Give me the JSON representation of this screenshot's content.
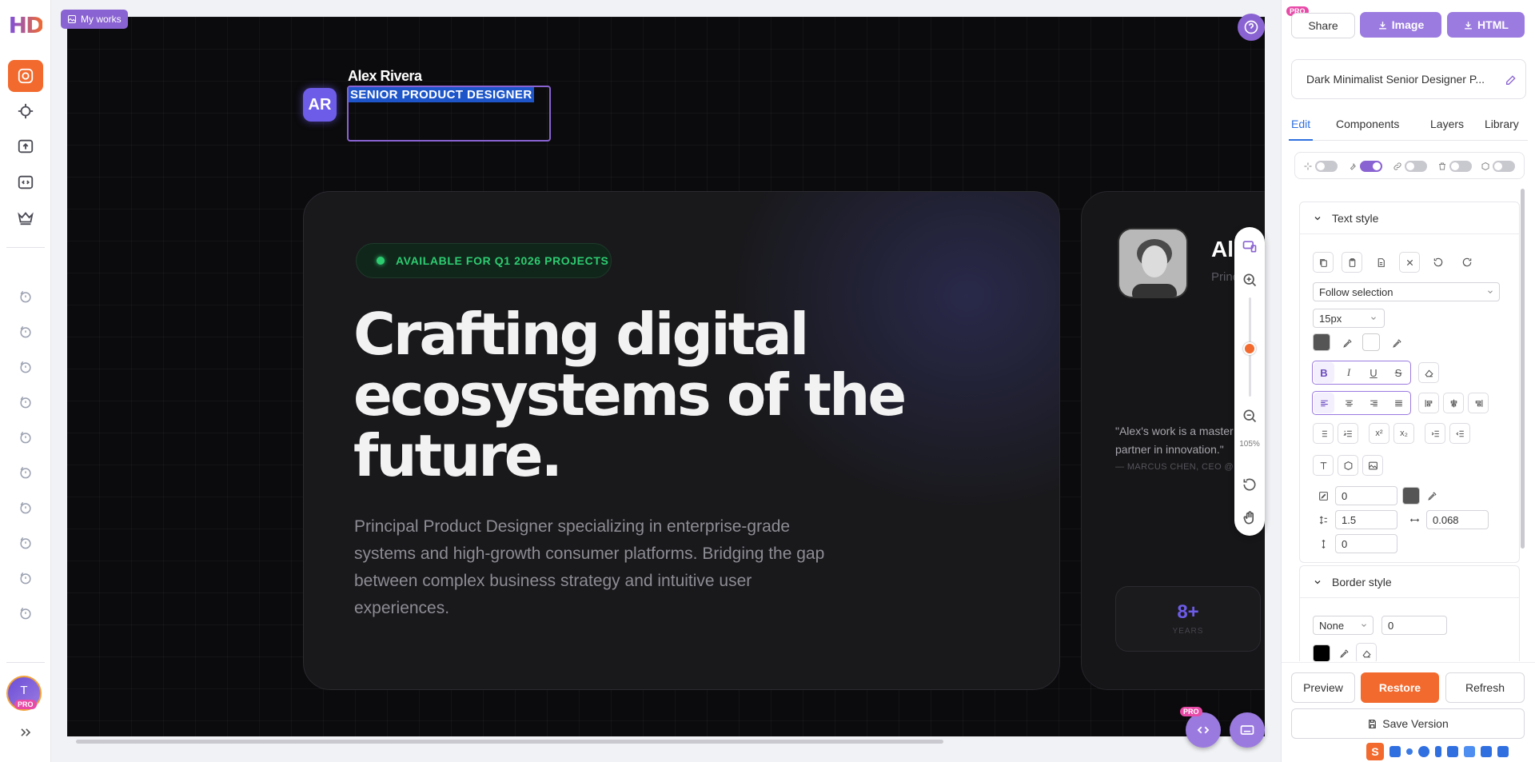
{
  "app": {
    "logo_text": "HD"
  },
  "rail": {
    "user_initial": "T",
    "pro_label": "PRO"
  },
  "canvas": {
    "my_works_label": "My works",
    "header": {
      "initials": "AR",
      "name": "Alex Rivera",
      "role": "SENIOR PRODUCT DESIGNER"
    },
    "main_card": {
      "availability": "AVAILABLE FOR Q1 2026 PROJECTS",
      "headline_line1": "Crafting digital",
      "headline_line2": "ecosystems of the",
      "headline_line3": "future.",
      "description": "Principal Product Designer specializing in enterprise-grade systems and high-growth consumer platforms. Bridging the gap between complex business strategy and intuitive user experiences."
    },
    "side_card": {
      "name_partial": "Ale",
      "role_partial": "Princ",
      "quote_line1": "\"Alex's work is a master",
      "quote_line2": "partner in innovation.\"",
      "quote_author": "— MARCUS CHEN, CEO @L",
      "stat_value": "8+",
      "stat_label": "YEARS"
    },
    "zoom_level": "105%",
    "zoom_fraction": 0.5,
    "pro_label": "PRO"
  },
  "panel": {
    "pro_label": "PRO",
    "share_label": "Share",
    "image_label": "Image",
    "html_label": "HTML",
    "project_title": "Dark Minimalist Senior Designer P...",
    "tabs": [
      "Edit",
      "Components",
      "Layers",
      "Library"
    ],
    "text_style": {
      "title": "Text style",
      "font_select": "Follow selection",
      "font_size": "15px",
      "stroke_width": "0",
      "line_height": "1.5",
      "letter_spacing": "0.068",
      "paragraph_spacing": "0"
    },
    "border_style": {
      "title": "Border style",
      "style": "None",
      "width": "0"
    },
    "preview_label": "Preview",
    "restore_label": "Restore",
    "refresh_label": "Refresh",
    "save_version_label": "Save Version"
  },
  "colors": {
    "accent": "#8a63d2",
    "orange": "#f26a2e",
    "green": "#2ecc71",
    "blue": "#2f6fe0"
  }
}
